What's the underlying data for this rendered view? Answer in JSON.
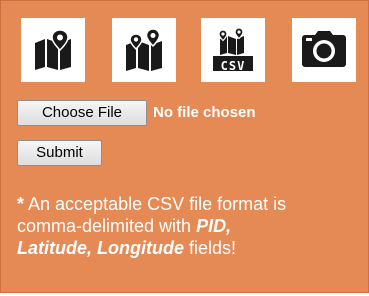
{
  "icons": [
    {
      "name": "map-pin-icon"
    },
    {
      "name": "map-pins-icon"
    },
    {
      "name": "map-csv-icon",
      "label": "CSV"
    },
    {
      "name": "camera-icon"
    }
  ],
  "file_input": {
    "button_label": "Choose File",
    "status": "No file chosen"
  },
  "submit_label": "Submit",
  "note": {
    "asterisk": "*",
    "line1": "An acceptable CSV file format is",
    "line2_prefix": "comma-delimited with ",
    "line2_em": "PID,",
    "line3_em": "Latitude, Longitude",
    "line3_suffix": " fields!"
  },
  "colors": {
    "panel_background": "#e68a55",
    "text": "#ffffff",
    "icon": "#1a1a1a"
  }
}
